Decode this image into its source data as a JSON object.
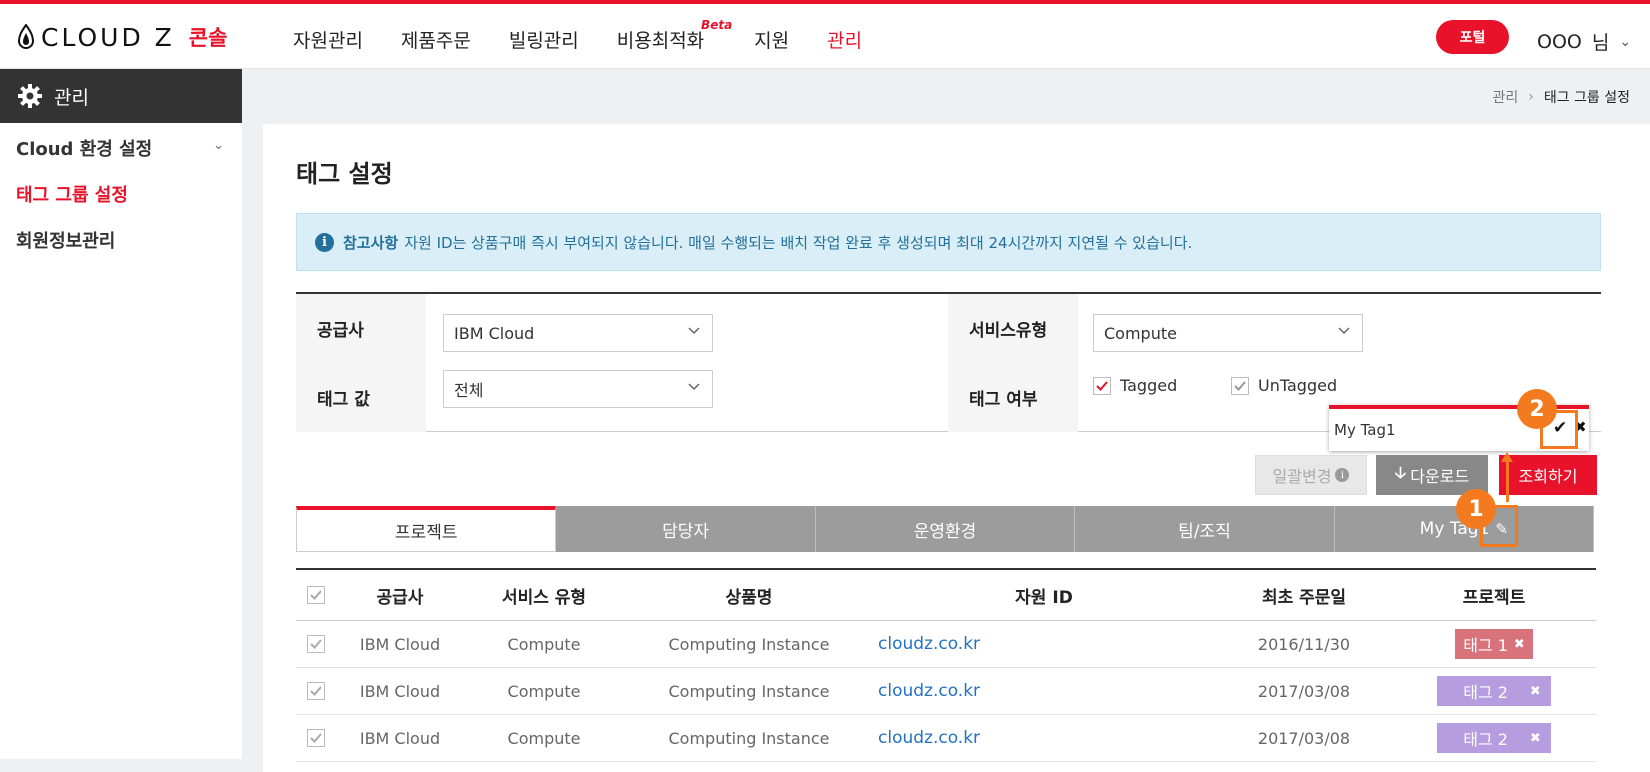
{
  "header": {
    "brand": "CLOUD Z",
    "brand_sub": "콘솔",
    "nav": [
      "자원관리",
      "제품주문",
      "빌링관리",
      "비용최적화",
      "지원",
      "관리"
    ],
    "beta_label": "Beta",
    "portal_label": "포털",
    "user_name": "OOO",
    "user_suffix": "님"
  },
  "sidebar": {
    "title": "관리",
    "items": [
      "Cloud 환경 설정",
      "태그 그룹 설정",
      "회원정보관리"
    ]
  },
  "breadcrumb": {
    "parent": "관리",
    "current": "태그 그룹 설정"
  },
  "page": {
    "title": "태그 설정",
    "notice_label": "참고사항",
    "notice_text": "자원 ID는 상품구매 즉시 부여되지 않습니다. 매일 수행되는 배치 작업 완료 후 생성되며 최대 24시간까지 지연될 수 있습니다."
  },
  "filter": {
    "provider_label": "공급사",
    "provider_value": "IBM Cloud",
    "service_label": "서비스유형",
    "service_value": "Compute",
    "tag_value_label": "태그 값",
    "tag_value_value": "전체",
    "tagged_label": "태그 여부",
    "tagged_option": "Tagged",
    "untagged_option": "UnTagged"
  },
  "tag_editor": {
    "value": "My Tag1",
    "confirm_icon": "✔",
    "close_icon": "✖"
  },
  "actions": {
    "bulk_label": "일괄변경",
    "download_label": "다운로드",
    "search_label": "조회하기"
  },
  "tabs": [
    "프로젝트",
    "담당자",
    "운영환경",
    "팀/조직",
    "My Tag1"
  ],
  "table": {
    "headers": [
      "공급사",
      "서비스 유형",
      "상품명",
      "자원 ID",
      "최초 주문일",
      "프로젝트"
    ],
    "rows": [
      {
        "provider": "IBM Cloud",
        "service": "Compute",
        "product": "Computing Instance",
        "resource": "cloudz.co.kr",
        "date": "2016/11/30",
        "tag": "태그 1"
      },
      {
        "provider": "IBM Cloud",
        "service": "Compute",
        "product": "Computing Instance",
        "resource": "cloudz.co.kr",
        "date": "2017/03/08",
        "tag": "태그 2"
      },
      {
        "provider": "IBM Cloud",
        "service": "Compute",
        "product": "Computing Instance",
        "resource": "cloudz.co.kr",
        "date": "2017/03/08",
        "tag": "태그 2"
      }
    ]
  },
  "annotations": [
    "1",
    "2"
  ],
  "colors": {
    "accent": "#e8132b",
    "annotation": "#f47a1f",
    "sidebar_head": "#333333",
    "link": "#2372c4"
  }
}
